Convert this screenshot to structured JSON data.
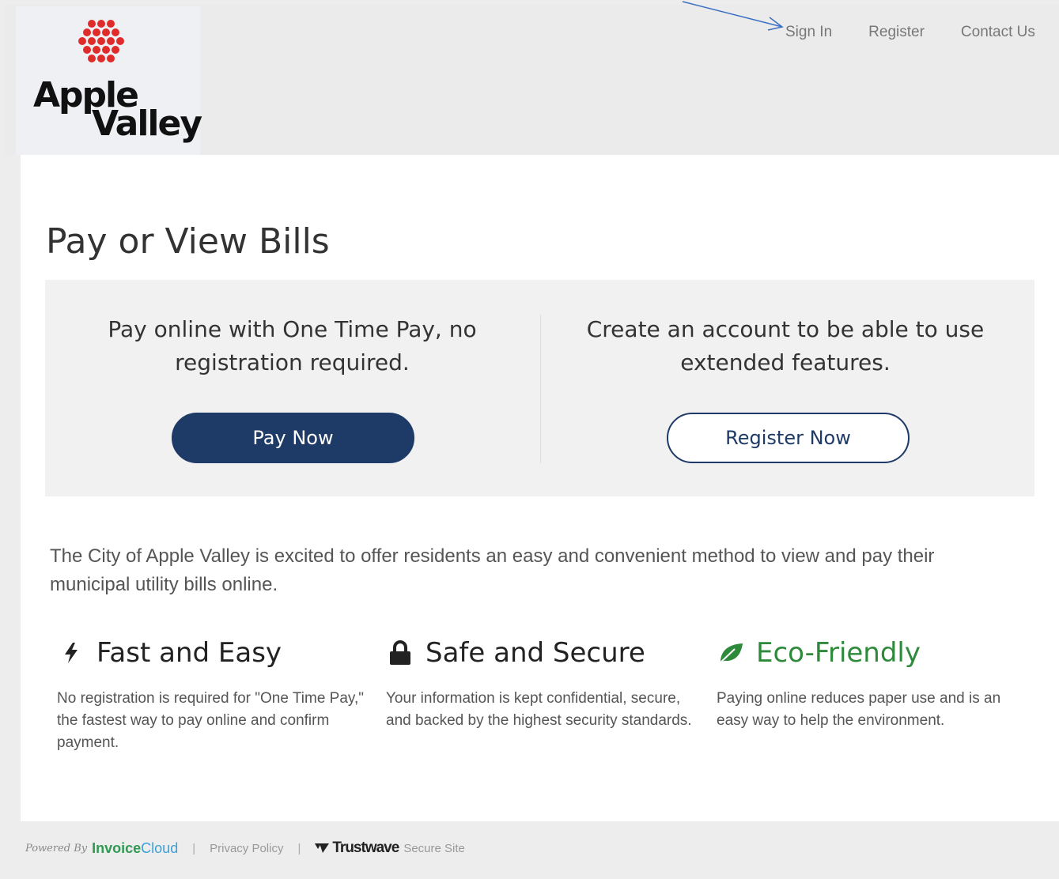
{
  "logo": {
    "line1": "Apple",
    "line2": "Valley"
  },
  "nav": {
    "items": [
      "Sign In",
      "Register",
      "Contact Us"
    ]
  },
  "page_title": "Pay or View Bills",
  "cta": {
    "left": {
      "text": "Pay online with One Time Pay, no registration required.",
      "button": "Pay Now"
    },
    "right": {
      "text": "Create an account to be able to use extended features.",
      "button": "Register Now"
    }
  },
  "intro": "The City of Apple Valley is excited to offer residents an easy and convenient method to view and pay their municipal utility bills online.",
  "features": [
    {
      "title": "Fast and Easy",
      "icon": "lightning-icon",
      "text": "No registration is required for \"One Time Pay,\" the fastest way to pay online and confirm payment."
    },
    {
      "title": "Safe and Secure",
      "icon": "lock-icon",
      "text": "Your information is kept confidential, secure, and backed by the highest security standards."
    },
    {
      "title": "Eco-Friendly",
      "icon": "leaf-icon",
      "text": "Paying online reduces paper use and is an easy way to help the environment."
    }
  ],
  "footer": {
    "powered_by": "Powered By",
    "brand_a": "Invoice",
    "brand_b": "Cloud",
    "sep": "|",
    "privacy": "Privacy Policy",
    "trust_brand": "Trustwave",
    "trust_text": "Secure Site"
  },
  "colors": {
    "primary": "#1e3a66",
    "eco": "#2d8a3a",
    "logo_dots": "#e02b2b"
  }
}
